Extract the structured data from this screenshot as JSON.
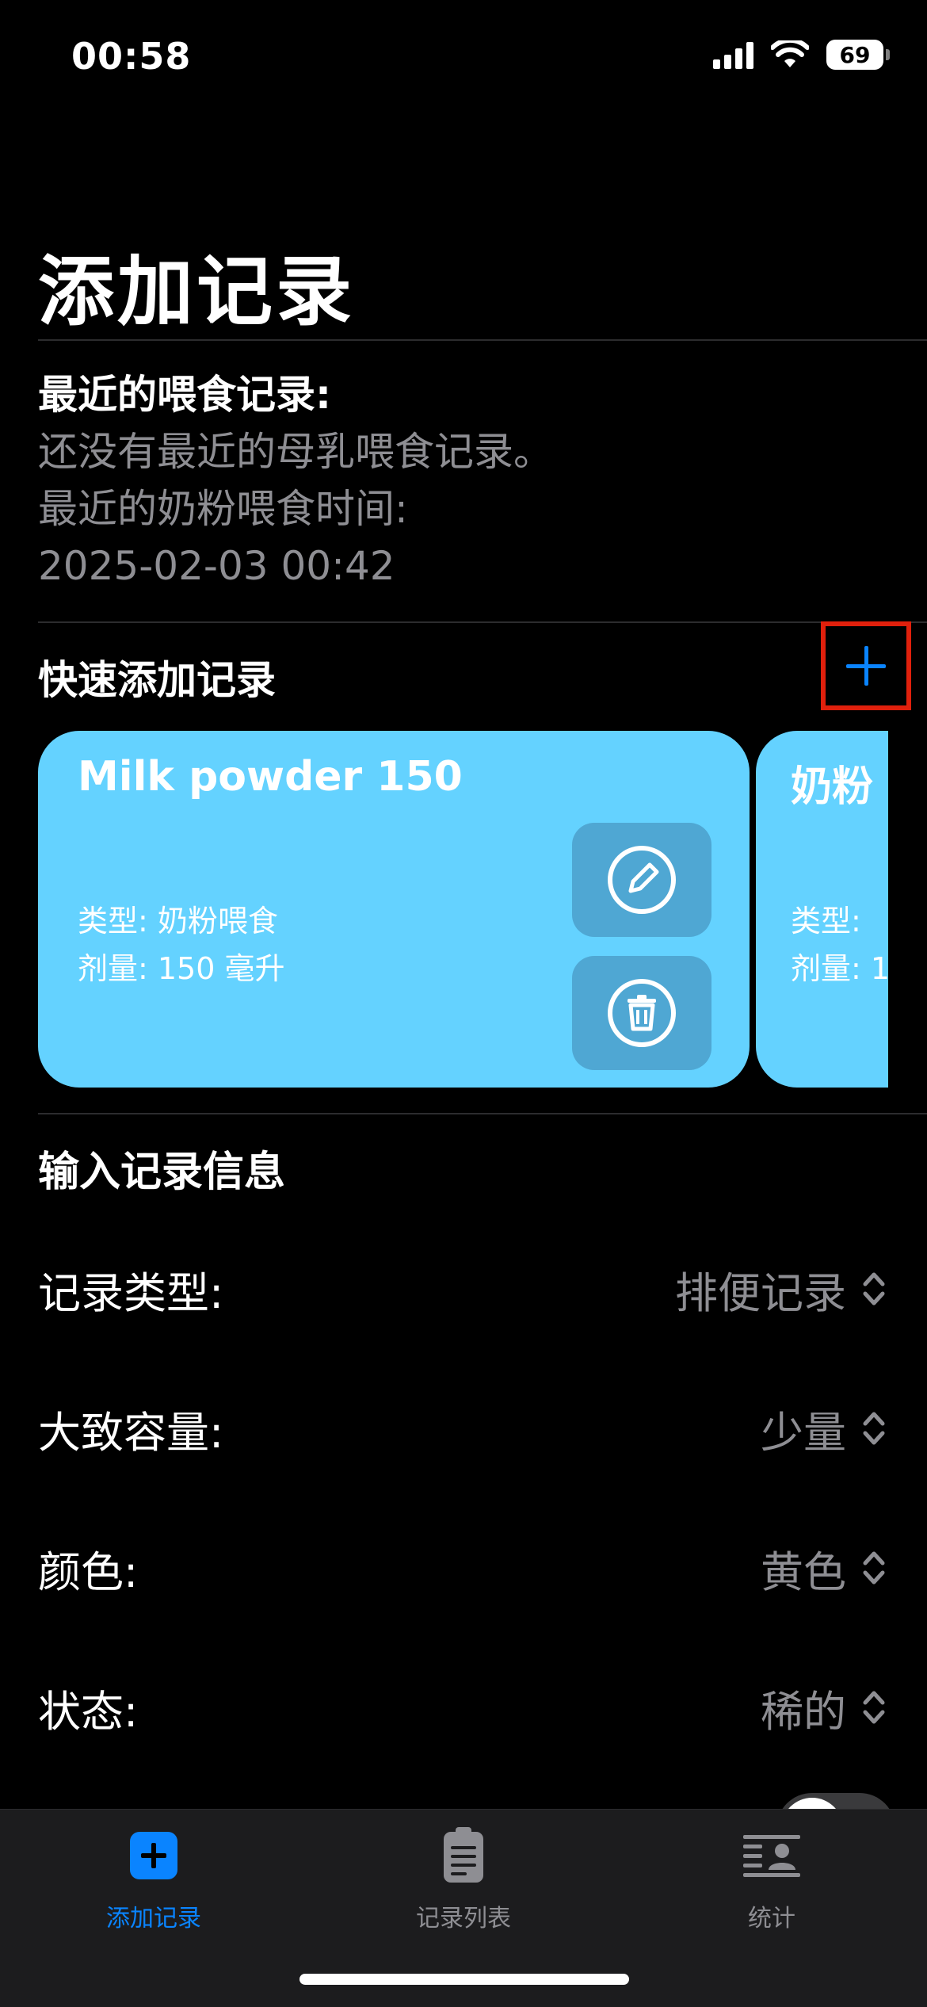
{
  "status_bar": {
    "time": "00:58",
    "battery": "69"
  },
  "page": {
    "title": "添加记录"
  },
  "recent": {
    "title": "最近的喂食记录:",
    "breast_milk_text": "还没有最近的母乳喂食记录。",
    "formula_label": "最近的奶粉喂食时间:",
    "formula_time": "2025-02-03 00:42"
  },
  "quick_add": {
    "title": "快速添加记录",
    "cards": [
      {
        "title": "Milk powder 150",
        "type_line": "类型:  奶粉喂食",
        "dose_line": "剂量: 150 毫升"
      },
      {
        "title": "奶粉",
        "type_line": "类型:",
        "dose_line": "剂量: 1"
      }
    ]
  },
  "input_section": {
    "title": "输入记录信息",
    "rows": [
      {
        "label": "记录类型:",
        "value": "排便记录"
      },
      {
        "label": "大致容量:",
        "value": "少量"
      },
      {
        "label": "颜色:",
        "value": "黄色"
      },
      {
        "label": "状态:",
        "value": "稀的"
      }
    ]
  },
  "tab_bar": {
    "tabs": [
      {
        "label": "添加记录",
        "icon": "plus-square-icon",
        "active": true
      },
      {
        "label": "记录列表",
        "icon": "clipboard-list-icon",
        "active": false
      },
      {
        "label": "统计",
        "icon": "person-text-icon",
        "active": false
      }
    ]
  },
  "colors": {
    "accent": "#0a84ff",
    "card": "#64d2ff",
    "highlight_border": "#e0200c"
  }
}
